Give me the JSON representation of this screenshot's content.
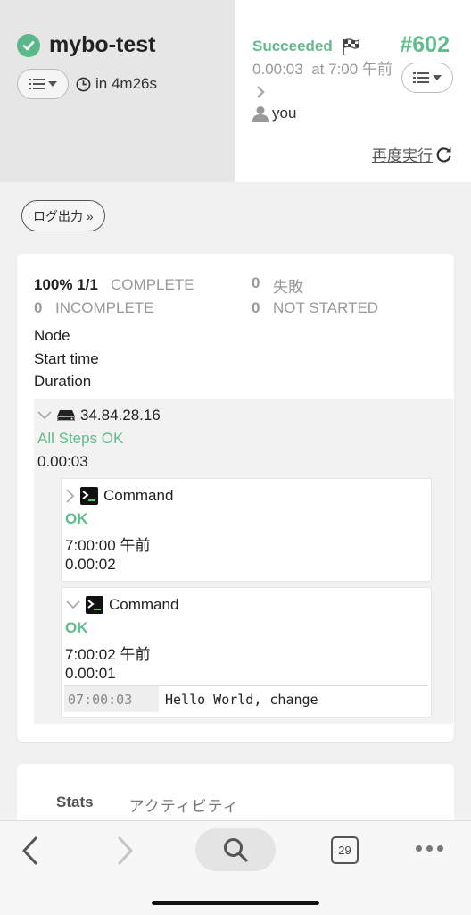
{
  "header": {
    "job_name": "mybo-test",
    "duration": "in 4m26s",
    "status": "Succeeded",
    "exec_id": "#602",
    "elapsed": "0.00:03",
    "at_time": "at 7:00 午前",
    "user": "you",
    "rerun_label": "再度実行"
  },
  "log_button": "ログ出力 »",
  "summary": {
    "percent": "100%",
    "ratio": "1/1",
    "complete_label": "COMPLETE",
    "failed_count": "0",
    "failed_label": "失敗",
    "incomplete_count": "0",
    "incomplete_label": "INCOMPLETE",
    "not_started_count": "0",
    "not_started_label": "NOT STARTED",
    "meta": [
      "Node",
      "Start time",
      "Duration"
    ]
  },
  "node": {
    "ip": "34.84.28.16",
    "status": "All Steps OK",
    "duration": "0.00:03",
    "steps": [
      {
        "label": "Command",
        "status": "OK",
        "time": "7:00:00 午前",
        "duration": "0.00:02"
      },
      {
        "label": "Command",
        "status": "OK",
        "time": "7:00:02 午前",
        "duration": "0.00:01",
        "log": {
          "timestamp": "07:00:03",
          "message": "Hello World, change"
        }
      }
    ]
  },
  "tabs": [
    "Stats",
    "アクティビティ"
  ],
  "browser": {
    "tab_count": "29"
  },
  "colors": {
    "success": "#62bb8d",
    "header_bg": "#e6e6e6",
    "page_bg": "#f1f1f1"
  }
}
